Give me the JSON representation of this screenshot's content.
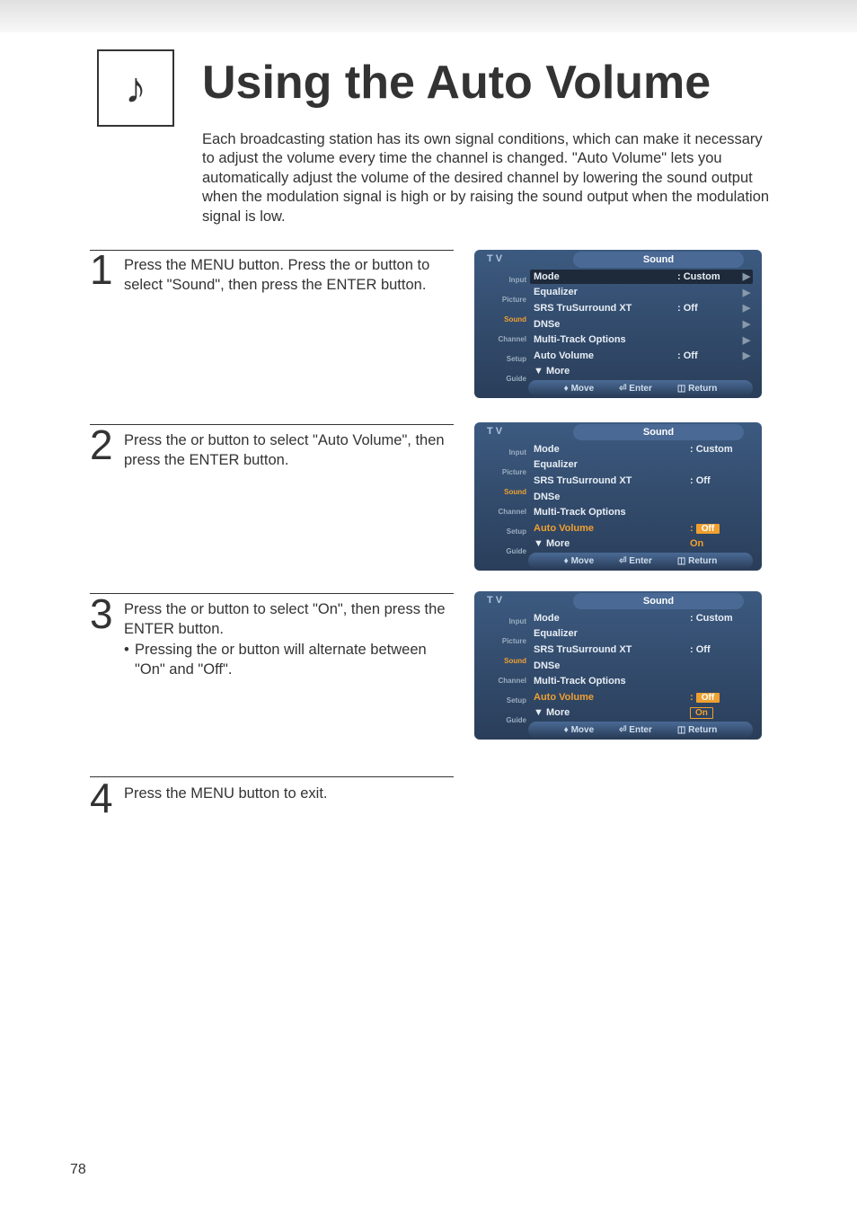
{
  "header": {
    "icon_name": "sound-note-icon",
    "title": "Using the Auto Volume",
    "intro": "Each broadcasting station has its own signal conditions, which can make it necessary to adjust the volume every time the channel is changed. \"Auto Volume\" lets you automatically adjust the volume of the desired channel by lowering the sound output when the modulation signal is high or by raising the sound output when the modulation signal is low."
  },
  "steps": {
    "one": {
      "num": "1",
      "body": "Press the MENU button. Press the     or     button to select \"Sound\", then press the ENTER button."
    },
    "two": {
      "num": "2",
      "body": "Press the     or     button to select \"Auto Volume\", then press the ENTER button."
    },
    "three": {
      "num": "3",
      "line1": "Press the     or     button to select \"On\", then press the ENTER button.",
      "bullet": "Pressing the     or     button will alternate between \"On\" and \"Off\"."
    },
    "four": {
      "num": "4",
      "body": "Press the MENU button to exit."
    }
  },
  "osd_common": {
    "tv": "T V",
    "title": "Sound",
    "sidebar": [
      "Input",
      "Picture",
      "Sound",
      "Channel",
      "Setup",
      "Guide"
    ],
    "footer": {
      "move": "Move",
      "enter": "Enter",
      "return": "Return"
    }
  },
  "osd1": {
    "rows": [
      {
        "left": "Mode",
        "right": ": Custom",
        "arrow": "▶",
        "first": true
      },
      {
        "left": "Equalizer",
        "right": "",
        "arrow": "▶"
      },
      {
        "left": "SRS TruSurround XT",
        "right": ": Off",
        "arrow": "▶"
      },
      {
        "left": "DNSe",
        "right": "",
        "arrow": "▶"
      },
      {
        "left": "Multi-Track Options",
        "right": "",
        "arrow": "▶"
      },
      {
        "left": "Auto Volume",
        "right": ": Off",
        "arrow": "▶"
      },
      {
        "left": "▼ More",
        "right": "",
        "arrow": ""
      }
    ]
  },
  "osd2": {
    "rows": [
      {
        "left": "Mode",
        "right": ": Custom"
      },
      {
        "left": "Equalizer",
        "right": ""
      },
      {
        "left": "SRS TruSurround XT",
        "right": ": Off"
      },
      {
        "left": "DNSe",
        "right": ""
      },
      {
        "left": "Multi-Track Options",
        "right": ""
      },
      {
        "left": "Auto Volume",
        "right_prefix": ":",
        "box": "Off",
        "hl": true
      },
      {
        "left": "▼ More",
        "on_below": "On"
      }
    ]
  },
  "osd3": {
    "rows": [
      {
        "left": "Mode",
        "right": ": Custom"
      },
      {
        "left": "Equalizer",
        "right": ""
      },
      {
        "left": "SRS TruSurround XT",
        "right": ": Off"
      },
      {
        "left": "DNSe",
        "right": ""
      },
      {
        "left": "Multi-Track Options",
        "right": ""
      },
      {
        "left": "Auto Volume",
        "right_prefix": ":",
        "box_off": "Off",
        "hl": true
      },
      {
        "left": "▼ More",
        "box_on": "On"
      }
    ]
  },
  "page_number": "78"
}
